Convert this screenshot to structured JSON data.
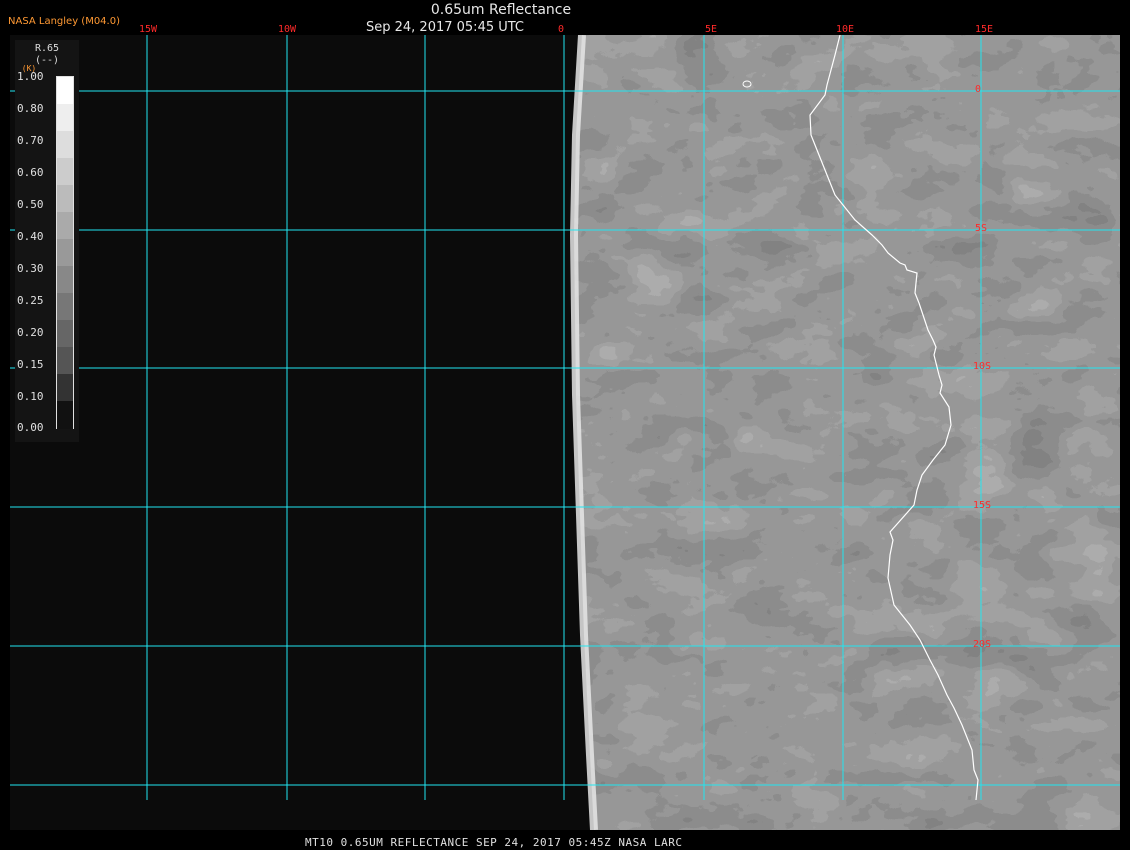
{
  "header": {
    "title": "0.65um Reflectance",
    "subtitle": "Sep 24, 2017 05:45 UTC",
    "producer": "NASA Langley (M04.0)"
  },
  "footer": {
    "text": "MT10  0.65UM REFLECTANCE   SEP 24, 2017 05:45Z   NASA LARC"
  },
  "legend": {
    "variable": "R.65",
    "units": "(--)",
    "corner_mark": "(K)",
    "ticks": [
      "1.00",
      "0.80",
      "0.70",
      "0.60",
      "0.50",
      "0.40",
      "0.30",
      "0.25",
      "0.20",
      "0.15",
      "0.10",
      "0.00"
    ],
    "colors": [
      "#ffffff",
      "#eeeeee",
      "#dddddd",
      "#cccccc",
      "#bbbbbb",
      "#aaaaaa",
      "#999999",
      "#888888",
      "#777777",
      "#666666",
      "#555555",
      "#333333",
      "#111111"
    ]
  },
  "map": {
    "longitude_labels": [
      "15W",
      "10W",
      "0",
      "5E",
      "10E",
      "15E"
    ],
    "latitude_labels": [
      "0",
      "5S",
      "10S",
      "15S",
      "20S"
    ],
    "grid_color": "#22e6f0",
    "label_color": "#ff2a2a",
    "coastline_color": "#ffffff",
    "background_color": "#0b0b0b"
  }
}
